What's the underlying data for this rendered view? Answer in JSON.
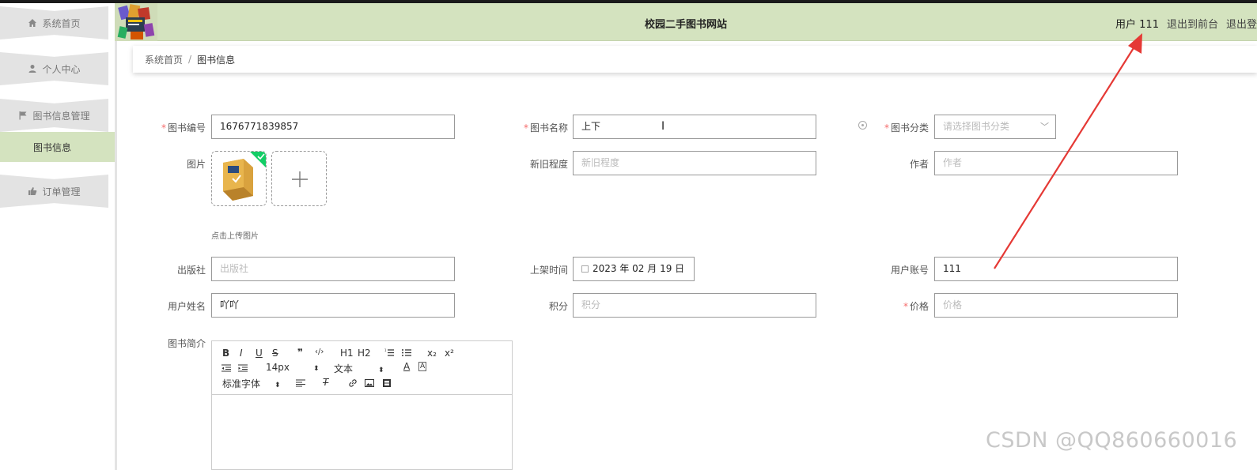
{
  "header": {
    "site_title": "校园二手图书网站",
    "user_label": "用户 111",
    "exit_front": "退出到前台",
    "exit_system": "退出登"
  },
  "sidebar": {
    "items": [
      {
        "label": "系统首页",
        "icon": "home-icon"
      },
      {
        "label": "个人中心",
        "icon": "user-icon"
      },
      {
        "label": "图书信息管理",
        "icon": "flag-icon"
      },
      {
        "label": "订单管理",
        "icon": "thumb-icon"
      }
    ],
    "submenu_active": "图书信息"
  },
  "breadcrumb": {
    "home": "系统首页",
    "separator": "/",
    "current": "图书信息"
  },
  "form": {
    "book_no": {
      "label": "图书编号",
      "value": "1676771839857",
      "required": "*"
    },
    "book_name": {
      "label": "图书名称",
      "value": "上下",
      "required": "*"
    },
    "book_category": {
      "label": "图书分类",
      "placeholder": "请选择图书分类",
      "required": "*"
    },
    "image": {
      "label": "图片",
      "tip": "点击上传图片"
    },
    "condition": {
      "label": "新旧程度",
      "placeholder": "新旧程度"
    },
    "author": {
      "label": "作者",
      "placeholder": "作者"
    },
    "publisher": {
      "label": "出版社",
      "placeholder": "出版社"
    },
    "shelf_time": {
      "label": "上架时间",
      "value": "2023 年 02 月 19 日"
    },
    "user_account": {
      "label": "用户账号",
      "value": "111"
    },
    "user_name": {
      "label": "用户姓名",
      "value": "吖吖"
    },
    "points": {
      "label": "积分",
      "placeholder": "积分"
    },
    "price": {
      "label": "价格",
      "placeholder": "价格",
      "required": "*"
    },
    "intro": {
      "label": "图书简介"
    }
  },
  "editor": {
    "font_size": "14px",
    "paragraph": "文本",
    "font_family": "标准字体",
    "buttons": [
      "B",
      "I",
      "U",
      "S",
      "❞",
      "‹/›",
      "H1",
      "H2",
      "list-ol",
      "list-ul",
      "x₂",
      "x²"
    ]
  },
  "watermark": "CSDN @QQ860660016",
  "colors": {
    "header_bg": "#d4e3bf",
    "menu_bg": "#e3e3e3",
    "required": "#f56c6c",
    "annotation_arrow": "#e53935"
  }
}
